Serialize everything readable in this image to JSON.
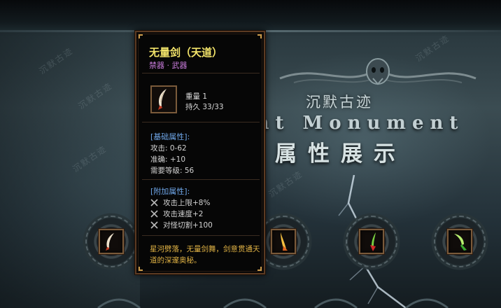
{
  "scene": {
    "watermark_text": "沉默古迹",
    "title_cn": "沉默古迹",
    "title_en": "ent Monument",
    "title_showcase": "属性展示"
  },
  "tooltip": {
    "name": "无量剑（天道）",
    "type": "禁器 · 武器",
    "weight_line": "重量 1",
    "durability_line": "持久 33/33",
    "base_header": "[基础属性]:",
    "base_stats": [
      "攻击: 0-62",
      "准确: +10",
      "需要等级: 56"
    ],
    "extra_header": "[附加属性]:",
    "extra_stats": [
      "攻击上限+8%",
      "攻击速度+2",
      "对怪切割+100"
    ],
    "description": "星河劈落，无量剑舞，剑意贯通天道的深邃奥秘。"
  },
  "slots": [
    {
      "name": "red-sword",
      "colors": [
        "#f0e0c8",
        "#c23a22"
      ]
    },
    {
      "name": "fire-sword",
      "colors": [
        "#f6c040",
        "#e06420"
      ]
    },
    {
      "name": "green-red-sword",
      "colors": [
        "#7ad040",
        "#d22a2a"
      ]
    },
    {
      "name": "green-blade",
      "colors": [
        "#b8f070",
        "#3aa830"
      ]
    }
  ],
  "colors": {
    "item_name": "#f3e46a",
    "item_type": "#c57ad8",
    "section_header": "#6fa6e8",
    "description": "#e0b244",
    "border": "#5b3a22"
  }
}
